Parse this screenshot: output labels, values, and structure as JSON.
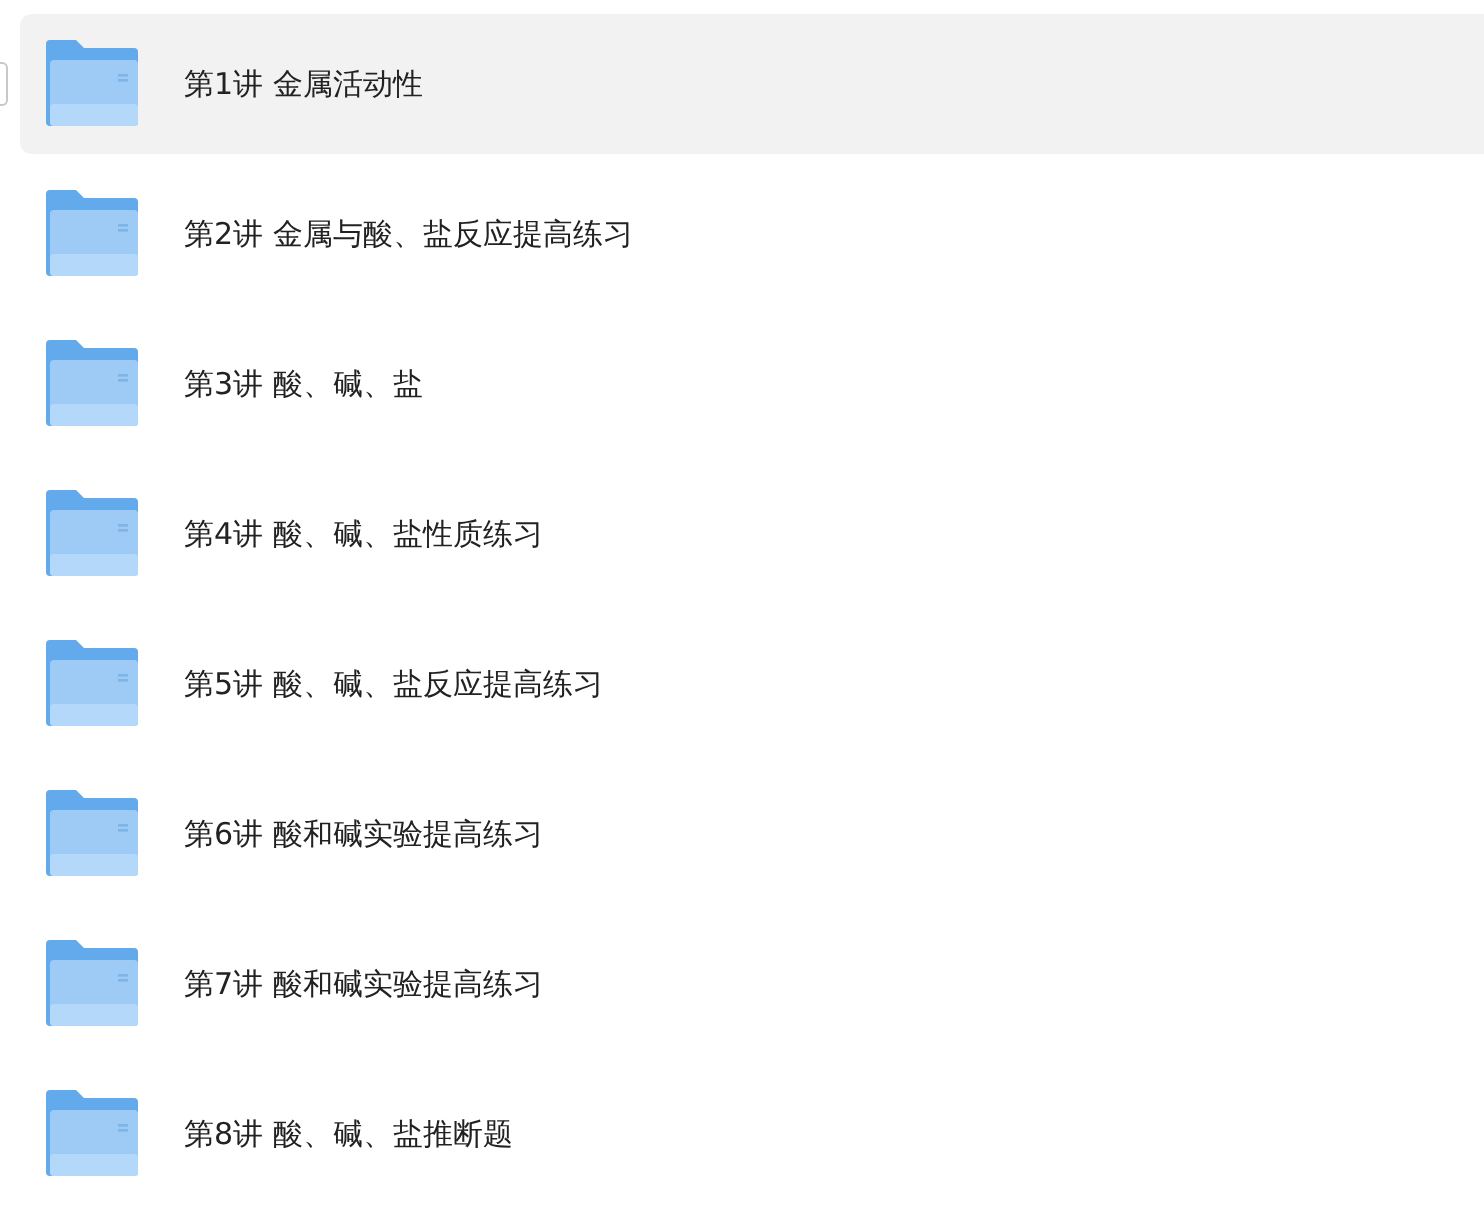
{
  "folders": [
    {
      "name": "第1讲 金属活动性",
      "highlighted": true
    },
    {
      "name": "第2讲 金属与酸、盐反应提高练习",
      "highlighted": false
    },
    {
      "name": "第3讲 酸、碱、盐",
      "highlighted": false
    },
    {
      "name": "第4讲 酸、碱、盐性质练习",
      "highlighted": false
    },
    {
      "name": "第5讲 酸、碱、盐反应提高练习",
      "highlighted": false
    },
    {
      "name": "第6讲 酸和碱实验提高练习",
      "highlighted": false
    },
    {
      "name": "第7讲 酸和碱实验提高练习",
      "highlighted": false
    },
    {
      "name": "第8讲 酸、碱、盐推断题",
      "highlighted": false
    }
  ]
}
